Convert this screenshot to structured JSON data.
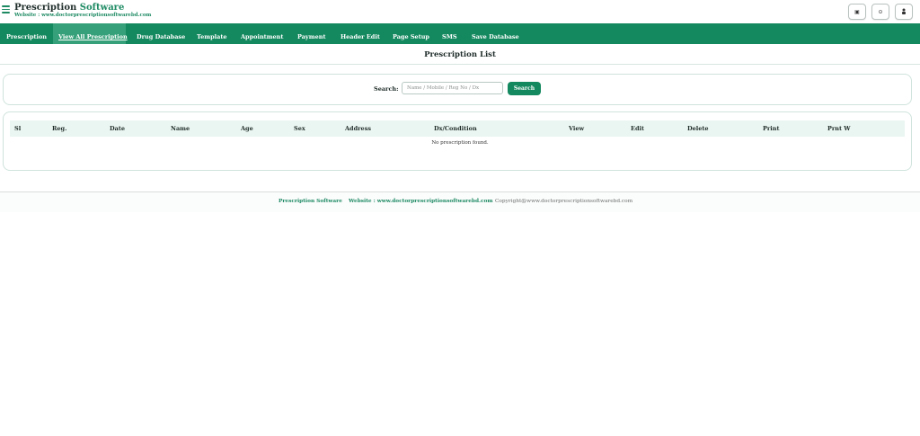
{
  "header": {
    "brand_primary": "Prescription",
    "brand_accent": "Software",
    "website": "Website : www.doctorprescriptionsoftwarebd.com",
    "actions": [
      {
        "icon": "window-icon",
        "glyph": "▣"
      },
      {
        "icon": "settings-icon",
        "glyph": "⊙"
      },
      {
        "icon": "user-icon",
        "glyph": "👤"
      }
    ]
  },
  "nav": {
    "items": [
      {
        "label": "Prescription",
        "active": false
      },
      {
        "label": "View All Prescription",
        "active": true
      },
      {
        "label": "Drug Database",
        "active": false
      },
      {
        "label": "Template",
        "active": false
      },
      {
        "label": "Appointment",
        "active": false
      },
      {
        "label": "Payment",
        "active": false
      },
      {
        "label": "Header Edit",
        "active": false
      },
      {
        "label": "Page Setup",
        "active": false
      },
      {
        "label": "SMS",
        "active": false
      },
      {
        "label": "Save Database",
        "active": false
      }
    ]
  },
  "main": {
    "title": "Prescription List",
    "search": {
      "label": "Search:",
      "placeholder": "Name / Mobile / Reg No / Dx",
      "value": "",
      "button": "Search"
    },
    "table": {
      "columns": [
        "Sl",
        "Reg.",
        "Date",
        "Name",
        "Age",
        "Sex",
        "Address",
        "Dx/Condition",
        "View",
        "Edit",
        "Delete",
        "Print",
        "Prnt W"
      ],
      "rows": [],
      "empty_message": "No prescription found."
    }
  },
  "footer": {
    "name": "Prescription Software",
    "website": "Website : www.doctorprescriptionsoftwarebd.com",
    "copyright": "Copyright@www.doctorprescriptionsoftwarebd.com"
  },
  "colors": {
    "primary": "#14885f",
    "active_tab": "#36a07a",
    "table_header_bg": "#eaf6f1"
  }
}
